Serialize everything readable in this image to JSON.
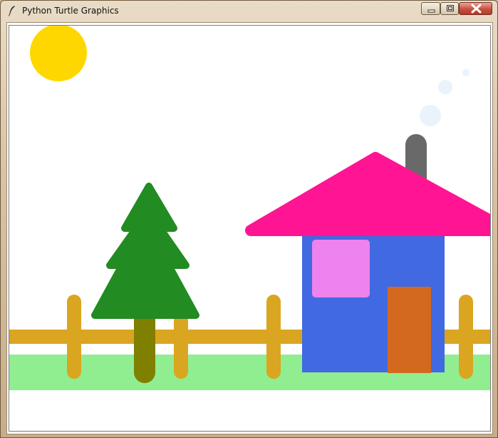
{
  "window": {
    "title": "Python Turtle Graphics",
    "icon": "feather-icon",
    "controls": [
      "minimize-icon",
      "maximize-icon",
      "close-icon"
    ]
  },
  "scene": {
    "colors": {
      "sun": "#FFD700",
      "smoke": "#EAF3FC",
      "chimney": "#696969",
      "roof": "#FF1493",
      "house_wall": "#4169E1",
      "window": "#EE82EE",
      "door": "#D2691E",
      "fence": "#DAA520",
      "grass": "#90EE90",
      "tree_leaves": "#228B22",
      "tree_trunk": "#808000"
    }
  }
}
